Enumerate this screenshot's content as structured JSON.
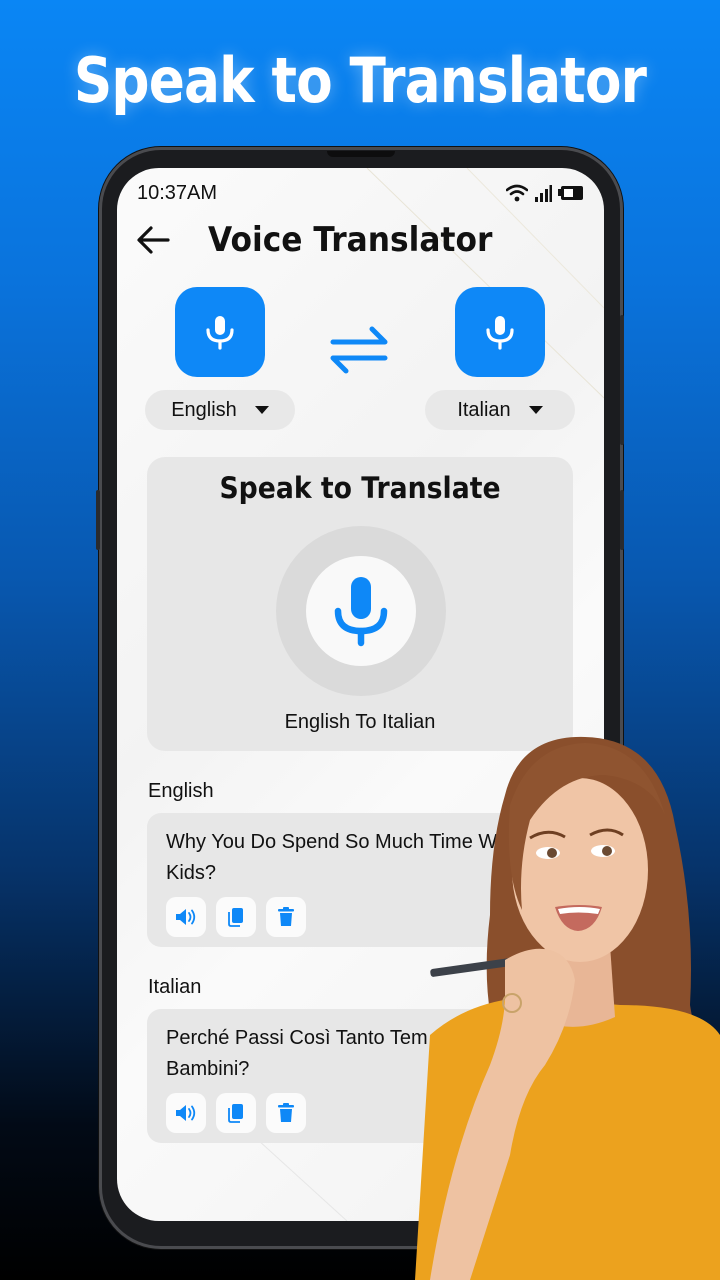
{
  "promo": {
    "headline": "Speak to Translator"
  },
  "status_bar": {
    "time": "10:37AM",
    "icons": [
      "wifi-icon",
      "signal-icon",
      "battery-icon"
    ]
  },
  "app_bar": {
    "back_icon": "arrow-left-icon",
    "title": "Voice Translator"
  },
  "language_selector": {
    "source": {
      "label": "English",
      "mic_icon": "mic-icon"
    },
    "target": {
      "label": "Italian",
      "mic_icon": "mic-icon"
    },
    "swap_icon": "swap-arrows-icon"
  },
  "speak_card": {
    "title": "Speak to Translate",
    "mic_icon": "mic-icon",
    "direction": "English To Italian"
  },
  "results": [
    {
      "language": "English",
      "text": "Why You Do Spend So Much Time With Kids?",
      "visible_text_line1": "Why You Do Spend So Much Time Wi",
      "visible_text_line2": "Kids?",
      "actions": [
        "speaker-icon",
        "copy-icon",
        "delete-icon"
      ]
    },
    {
      "language": "Italian",
      "text": "Perché Passi Così Tanto Tempo Con I Bambini?",
      "visible_text_line1": "Perché Passi Così Tanto Tem",
      "visible_text_line2": "Bambini?",
      "actions": [
        "speaker-icon",
        "copy-icon",
        "delete-icon"
      ]
    }
  ],
  "colors": {
    "accent": "#0e88f7",
    "card_bg": "#e7e7e7",
    "promo_bg_top": "#0a86f5",
    "promo_bg_bottom": "#000000"
  }
}
